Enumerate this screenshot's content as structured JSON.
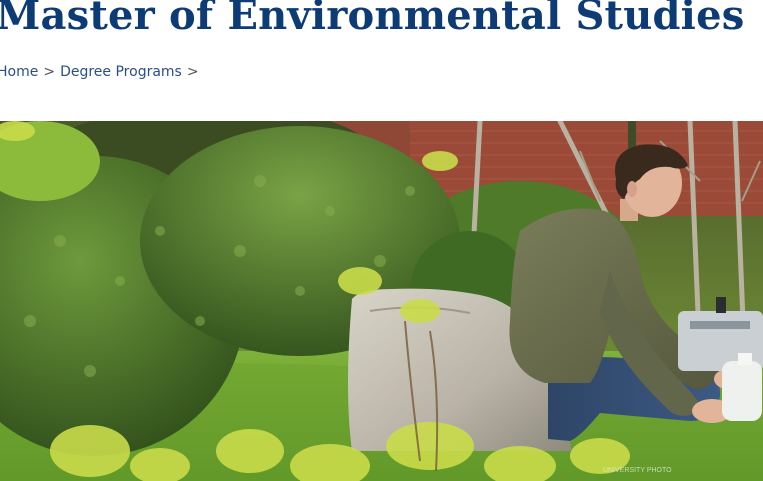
{
  "page": {
    "title": "Master of Environmental Studies"
  },
  "breadcrumb": {
    "items": [
      {
        "label": "Home"
      },
      {
        "label": "Degree Programs"
      }
    ],
    "separator": ">"
  },
  "hero": {
    "photo_credit": "UNIVERSITY PHOTO"
  },
  "colors": {
    "title": "#0d3b76",
    "link": "#2a4f86",
    "foliage": "#5f8a2c",
    "brick": "#9a4a36"
  }
}
